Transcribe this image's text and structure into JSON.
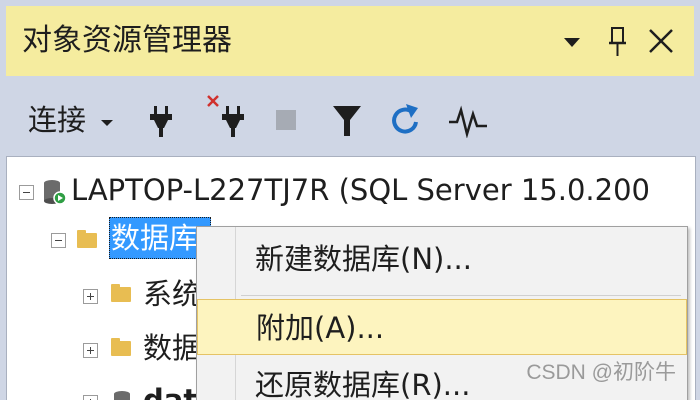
{
  "window": {
    "title": "对象资源管理器",
    "buttons": {
      "dropdown_icon": "dropdown-arrow-icon",
      "pin_icon": "pin-icon",
      "close_icon": "close-icon"
    }
  },
  "toolbar": {
    "connect_label": "连接",
    "icons": [
      "connect-plug-icon",
      "disconnect-plug-icon",
      "stop-icon",
      "filter-icon",
      "refresh-icon",
      "activity-monitor-icon"
    ]
  },
  "tree": {
    "server": "LAPTOP-L227TJ7R (SQL Server 15.0.200",
    "databases": "数据库",
    "child_system": "系统",
    "child_snapshot": "数据",
    "child_db": "data"
  },
  "context_menu": {
    "items": [
      "新建数据库(N)...",
      "附加(A)...",
      "还原数据库(R)..."
    ],
    "highlighted_index": 1
  },
  "watermark": "CSDN @初阶牛",
  "colors": {
    "title_bg": "#f5ec9f",
    "toolbar_bg": "#cfd6e5",
    "selection": "#3399ff",
    "menu_hover": "#fdf4bf"
  }
}
